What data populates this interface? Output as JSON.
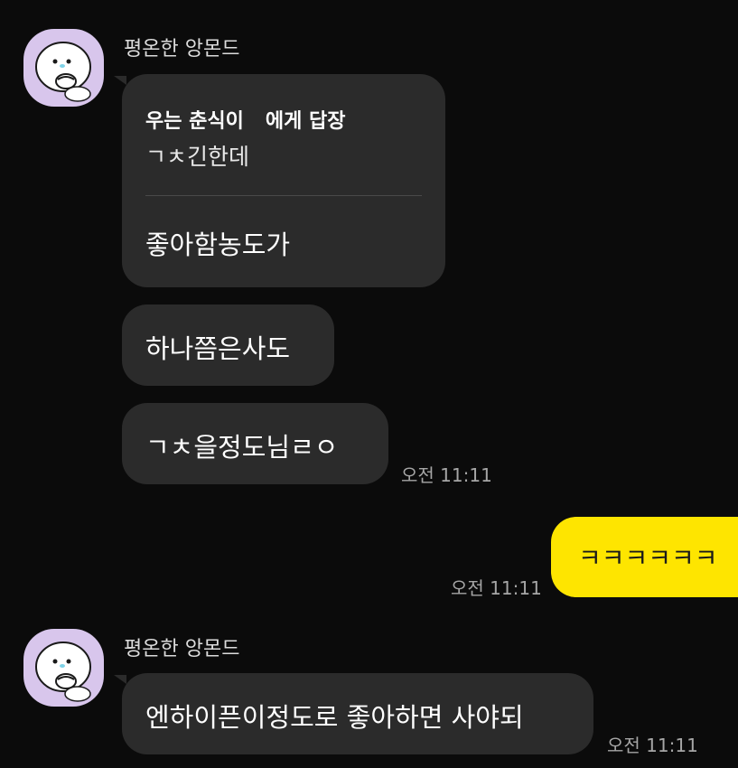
{
  "messages": [
    {
      "sender": "평온한 앙몬드",
      "reply_to": "우는 춘식이",
      "reply_suffix": "에게 답장",
      "quoted_text": "ㄱㅊ긴한데",
      "text": "좋아함농도가"
    },
    {
      "text": "하나쯤은사도"
    },
    {
      "text": "ㄱㅊ을정도님ㄹㅇ",
      "time": "오전 11:11"
    },
    {
      "text": "ㅋㅋㅋㅋㅋㅋ",
      "time": "오전 11:11",
      "mine": true
    },
    {
      "sender": "평온한 앙몬드",
      "text": "엔하이픈이정도로 좋아하면 사야되",
      "time": "오전 11:11"
    }
  ],
  "colors": {
    "background": "#0b0b0b",
    "incoming_bubble": "#2b2b2b",
    "outgoing_bubble": "#fee500",
    "avatar_bg": "#d8c6ec",
    "time_text": "#a6a6a6"
  },
  "icons": {
    "avatar": "white-bear-character-avatar"
  }
}
